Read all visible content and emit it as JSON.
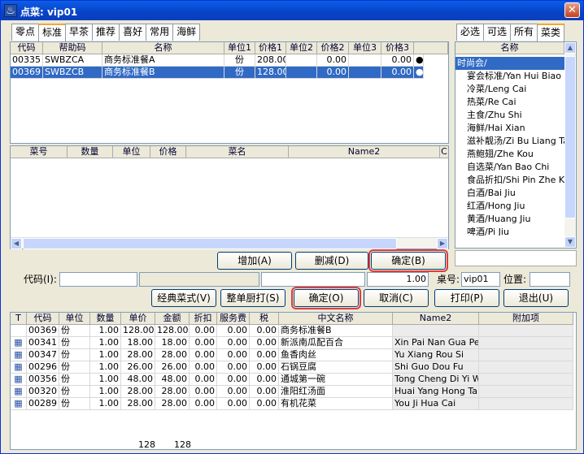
{
  "window": {
    "title": "点菜: vip01",
    "close_glyph": "✕"
  },
  "top_tabs": [
    "零点",
    "标准",
    "早茶",
    "推荐",
    "喜好",
    "常用",
    "海鲜"
  ],
  "right_tabs": [
    "必选",
    "可选",
    "所有",
    "菜类"
  ],
  "package_grid": {
    "headers": [
      "代码",
      "帮助码",
      "名称",
      "单位1",
      "价格1",
      "单位2",
      "价格2",
      "单位3",
      "价格3",
      ""
    ],
    "rows": [
      {
        "code": "00335",
        "help": "SWBZCA",
        "name": "商务标准餐A",
        "unit1": "份",
        "price1": "208.00",
        "unit2": "",
        "price2": "0.00",
        "unit3": "",
        "price3": "0.00",
        "mark": "●"
      },
      {
        "code": "00369",
        "help": "SWBZCB",
        "name": "商务标准餐B",
        "unit1": "份",
        "price1": "128.00",
        "unit2": "",
        "price2": "0.00",
        "unit3": "",
        "price3": "0.00",
        "mark": "●"
      }
    ]
  },
  "detail_grid": {
    "headers": [
      "菜号",
      "数量",
      "单位",
      "价格",
      "菜名",
      "Name2",
      "C"
    ]
  },
  "category_tree": {
    "header": "名称",
    "items": [
      "时尚会/",
      "宴会标准/Yan Hui Biao Zhu",
      "冷菜/Leng Cai",
      "热菜/Re Cai",
      "主食/Zhu Shi",
      "海鲜/Hai Xian",
      "滋补靓汤/Zi Bu Liang Tang",
      "燕鲍翅/Zhe Kou",
      "自选菜/Yan Bao Chi",
      "食品折扣/Shi Pin Zhe Kou",
      "白酒/Bai Jiu",
      "红酒/Hong Jiu",
      "黄酒/Huang Jiu",
      "啤酒/Pi Jiu"
    ]
  },
  "actions": {
    "add": "增加(A)",
    "delete": "删减(D)",
    "confirm_b": "确定(B)"
  },
  "form": {
    "code_label": "代码(I):",
    "qty_value": "1.00",
    "table_label": "桌号:",
    "table_value": "vip01",
    "position_label": "位置:",
    "position_value": ""
  },
  "buttons": {
    "classic": "经典菜式(V)",
    "whole_print": "整单厨打(S)",
    "confirm_o": "确定(O)",
    "cancel": "取消(C)",
    "print": "打印(P)",
    "exit": "退出(U)"
  },
  "order_grid": {
    "headers": [
      "T",
      "代码",
      "单位",
      "数量",
      "单价",
      "金额",
      "折扣",
      "服务费",
      "税",
      "中文名称",
      "Name2",
      "附加项"
    ],
    "rows": [
      {
        "t": "",
        "code": "00369",
        "unit": "份",
        "qty": "1.00",
        "price": "128.00",
        "amount": "128.00",
        "disc": "0.00",
        "svc": "0.00",
        "tax": "0.00",
        "cn": "商务标准餐B",
        "name2": ""
      },
      {
        "t": "▦",
        "code": "00341",
        "unit": "份",
        "qty": "1.00",
        "price": "18.00",
        "amount": "18.00",
        "disc": "0.00",
        "svc": "0.00",
        "tax": "0.00",
        "cn": "新派南瓜配百合",
        "name2": "Xin Pai Nan Gua Pei Ba"
      },
      {
        "t": "▦",
        "code": "00347",
        "unit": "份",
        "qty": "1.00",
        "price": "28.00",
        "amount": "28.00",
        "disc": "0.00",
        "svc": "0.00",
        "tax": "0.00",
        "cn": "鱼香肉丝",
        "name2": "Yu Xiang Rou Si"
      },
      {
        "t": "▦",
        "code": "00296",
        "unit": "份",
        "qty": "1.00",
        "price": "26.00",
        "amount": "26.00",
        "disc": "0.00",
        "svc": "0.00",
        "tax": "0.00",
        "cn": "石锅豆腐",
        "name2": "Shi Guo Dou Fu"
      },
      {
        "t": "▦",
        "code": "00356",
        "unit": "份",
        "qty": "1.00",
        "price": "48.00",
        "amount": "48.00",
        "disc": "0.00",
        "svc": "0.00",
        "tax": "0.00",
        "cn": "通城第一碗",
        "name2": "Tong Cheng Di Yi Wan"
      },
      {
        "t": "▦",
        "code": "00320",
        "unit": "份",
        "qty": "1.00",
        "price": "28.00",
        "amount": "28.00",
        "disc": "0.00",
        "svc": "0.00",
        "tax": "0.00",
        "cn": "淮阳红汤面",
        "name2": "Huai Yang Hong Tang M"
      },
      {
        "t": "▦",
        "code": "00289",
        "unit": "份",
        "qty": "1.00",
        "price": "28.00",
        "amount": "28.00",
        "disc": "0.00",
        "svc": "0.00",
        "tax": "0.00",
        "cn": "有机花菜",
        "name2": "You Ji Hua Cai"
      }
    ],
    "totals": {
      "price": "128",
      "amount": "128"
    }
  }
}
